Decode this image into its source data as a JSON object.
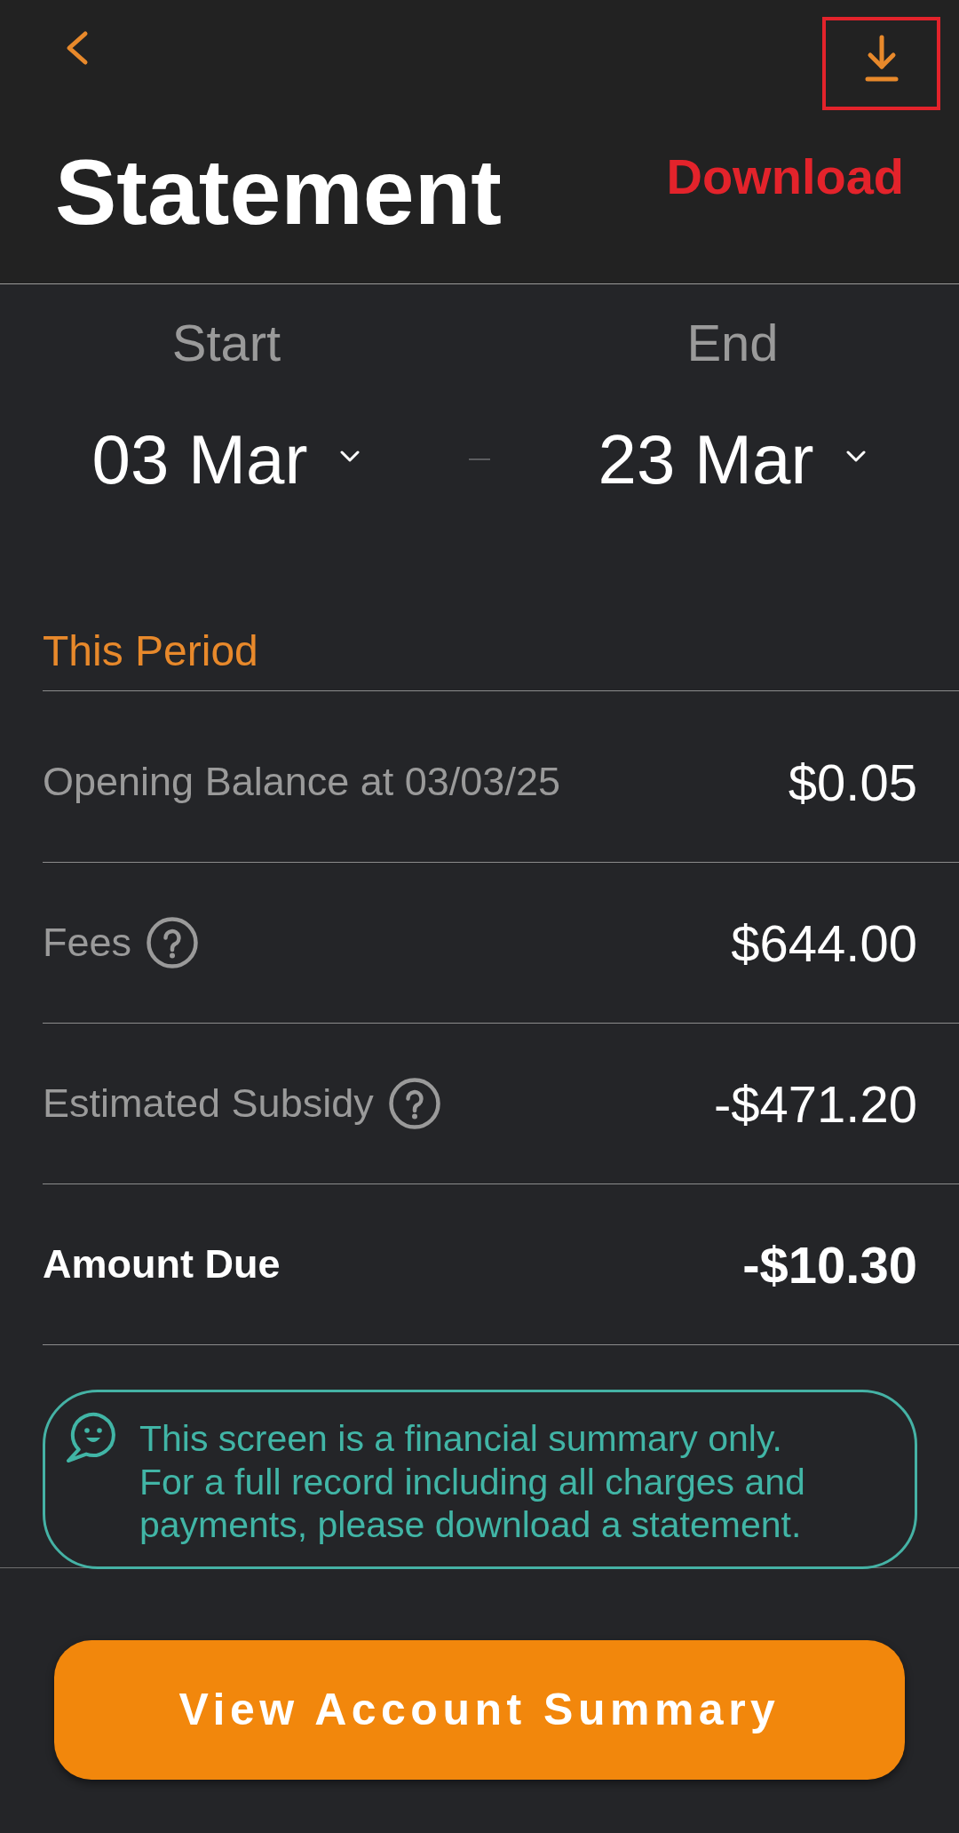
{
  "header": {
    "title": "Statement"
  },
  "annotation": {
    "label": "Download"
  },
  "date_range": {
    "start": {
      "label": "Start",
      "value": "03 Mar"
    },
    "end": {
      "label": "End",
      "value": "23 Mar"
    }
  },
  "period": {
    "title": "This Period",
    "rows": [
      {
        "kind": "plain",
        "label": "Opening Balance at 03/03/25",
        "value": "$0.05"
      },
      {
        "kind": "help",
        "label": "Fees",
        "value": "$644.00"
      },
      {
        "kind": "help",
        "label": "Estimated Subsidy",
        "value": "-$471.20"
      },
      {
        "kind": "total",
        "label": "Amount Due",
        "value": "-$10.30"
      }
    ]
  },
  "note": {
    "lines": [
      "This screen is a financial summary only.",
      "For a full record including all charges and",
      "payments, please download a statement."
    ]
  },
  "primary_button": {
    "label": "View Account Summary"
  }
}
